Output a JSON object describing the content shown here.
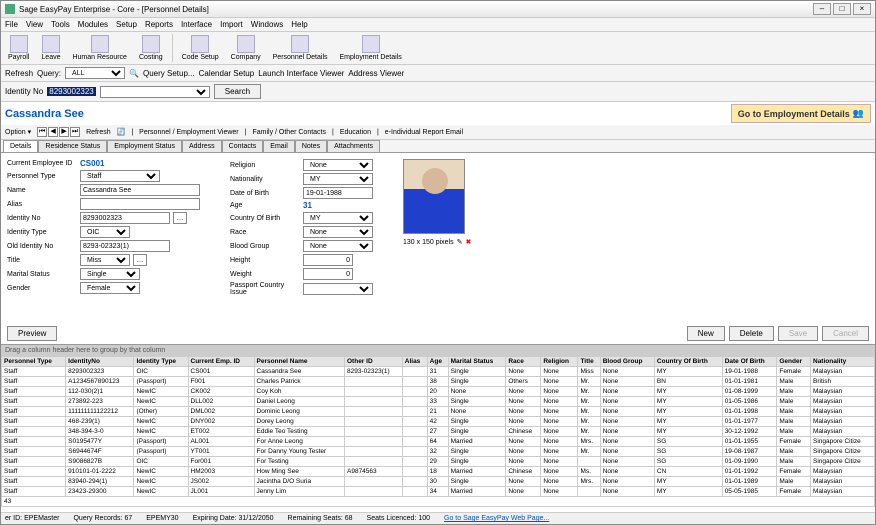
{
  "window": {
    "title": "Sage EasyPay Enterprise - Core - [Personnel Details]"
  },
  "menu": [
    "File",
    "View",
    "Tools",
    "Modules",
    "Setup",
    "Reports",
    "Interface",
    "Import",
    "Windows",
    "Help"
  ],
  "toolbar": [
    "Payroll",
    "Leave",
    "Human Resource",
    "Costing",
    "Code Setup",
    "Company",
    "Personnel Details",
    "Employment Details"
  ],
  "query": {
    "refresh": "Refresh",
    "query": "Query:",
    "all": "ALL",
    "setup": "Query Setup...",
    "calendar": "Calendar Setup",
    "launch": "Launch Interface Viewer",
    "address": "Address Viewer"
  },
  "idbar": {
    "label": "Identity No",
    "value": "8293002323",
    "search": "Search"
  },
  "header": {
    "goto": "Go to  Employment Details"
  },
  "optbar": {
    "option": "Option ▾",
    "refresh": "Refresh",
    "pev": "Personnel / Employment Viewer",
    "family": "Family / Other Contacts",
    "education": "Education",
    "eind": "e-Individual Report Email"
  },
  "tabs": [
    "Details",
    "Residence Status",
    "Employment Status",
    "Address",
    "Contacts",
    "Email",
    "Notes",
    "Attachments"
  ],
  "form": {
    "l": {
      "empid": "Current Employee ID",
      "ptype": "Personnel Type",
      "name": "Name",
      "alias": "Alias",
      "idno": "Identity No",
      "idtype": "Identity Type",
      "oldid": "Old Identity No",
      "title": "Title",
      "marital": "Marital Status",
      "gender": "Gender"
    },
    "r": {
      "religion": "Religion",
      "nat": "Nationality",
      "dob": "Date of Birth",
      "age": "Age",
      "cob": "Country Of Birth",
      "race": "Race",
      "blood": "Blood Group",
      "height": "Height",
      "weight": "Weight",
      "passport": "Passport Country Issue"
    }
  },
  "person": {
    "empid": "CS001",
    "ptype": "Staff",
    "name": "Cassandra See",
    "idno": "8293002323",
    "idtype": "OIC",
    "oldid": "8293-02323(1)",
    "title": "Miss",
    "marital": "Single",
    "gender": "Female",
    "religion": "None",
    "nationality": "MY",
    "dob": "19-01-1988",
    "age": "31",
    "cob": "MY",
    "race": "None",
    "blood": "None",
    "height": "0",
    "weight": "0"
  },
  "photo": {
    "size": "130 x 150 pixels"
  },
  "buttons": {
    "preview": "Preview",
    "new": "New",
    "delete": "Delete",
    "save": "Save",
    "cancel": "Cancel"
  },
  "grid": {
    "hint": "Drag a column header here to group by that column",
    "cols": [
      "Personnel Type",
      "IdentityNo",
      "Identity Type",
      "Current Emp. ID",
      "Personnel Name",
      "Other ID",
      "Alias",
      "Age",
      "Marital Status",
      "Race",
      "Religion",
      "Title",
      "Blood Group",
      "Country Of Birth",
      "Date Of Birth",
      "Gender",
      "Nationality"
    ],
    "rows": [
      [
        "Staff",
        "8293002323",
        "OIC",
        "CS001",
        "Cassandra See",
        "8293-02323(1)",
        "",
        "31",
        "Single",
        "None",
        "None",
        "Miss",
        "None",
        "MY",
        "19-01-1988",
        "Female",
        "Malaysian"
      ],
      [
        "Staff",
        "A1234567890123",
        "(Passport)",
        "F001",
        "Charles Patrick",
        "",
        "",
        "38",
        "Single",
        "Others",
        "None",
        "Mr.",
        "None",
        "BN",
        "01-01-1981",
        "Male",
        "British"
      ],
      [
        "Staff",
        "112-030(2)1",
        "NewIC",
        "CK002",
        "Coy Koh",
        "",
        "",
        "20",
        "None",
        "None",
        "None",
        "Mr.",
        "None",
        "MY",
        "01-08-1999",
        "Male",
        "Malaysian"
      ],
      [
        "Staff",
        "273892-223",
        "NewIC",
        "DLL002",
        "Daniel Leong",
        "",
        "",
        "33",
        "Single",
        "None",
        "None",
        "Mr.",
        "None",
        "MY",
        "01-05-1986",
        "Male",
        "Malaysian"
      ],
      [
        "Staff",
        "111111111122212",
        "(Other)",
        "DML002",
        "Dominic Leong",
        "",
        "",
        "21",
        "None",
        "None",
        "None",
        "Mr.",
        "None",
        "MY",
        "01-01-1998",
        "Male",
        "Malaysian"
      ],
      [
        "Staff",
        "468-239(1)",
        "NewIC",
        "DNY002",
        "Dorey Leong",
        "",
        "",
        "42",
        "Single",
        "None",
        "None",
        "Mr.",
        "None",
        "MY",
        "01-01-1977",
        "Male",
        "Malaysian"
      ],
      [
        "Staff",
        "348-394-3-0",
        "NewIC",
        "ET002",
        "Eddie Teo Testing",
        "",
        "",
        "27",
        "Single",
        "Chinese",
        "None",
        "Mr.",
        "None",
        "MY",
        "30-12-1992",
        "Male",
        "Malaysian"
      ],
      [
        "Staff",
        "S0195477Y",
        "(Passport)",
        "AL001",
        "For Anne Leong",
        "",
        "",
        "64",
        "Married",
        "None",
        "None",
        "Mrs.",
        "None",
        "SG",
        "01-01-1955",
        "Female",
        "Singapore Citize"
      ],
      [
        "Staff",
        "S6944674F",
        "(Passport)",
        "YT001",
        "For Danny Young Tester",
        "",
        "",
        "32",
        "Single",
        "None",
        "None",
        "Mr.",
        "None",
        "SG",
        "19-08-1987",
        "Male",
        "Singapore Citize"
      ],
      [
        "Staff",
        "S9086827B",
        "OIC",
        "For001",
        "For Testing",
        "",
        "",
        "29",
        "Single",
        "None",
        "None",
        "",
        "None",
        "SG",
        "01-09-1990",
        "Male",
        "Singapore Citize"
      ],
      [
        "Staff",
        "910101-01-2222",
        "NewIC",
        "HM2003",
        "How Ming See",
        "A9874563",
        "",
        "18",
        "Married",
        "Chinese",
        "None",
        "Ms.",
        "None",
        "CN",
        "01-01-1992",
        "Female",
        "Malaysian"
      ],
      [
        "Staff",
        "83940-294(1)",
        "NewIC",
        "JS002",
        "Jacintha D/O Suria",
        "",
        "",
        "30",
        "Single",
        "None",
        "None",
        "Mrs.",
        "None",
        "MY",
        "01-01-1989",
        "Male",
        "Malaysian"
      ],
      [
        "Staff",
        "23423-29300",
        "NewIC",
        "JL001",
        "Jenny Lim",
        "",
        "",
        "34",
        "Married",
        "None",
        "None",
        "",
        "None",
        "MY",
        "05-05-1985",
        "Female",
        "Malaysian"
      ]
    ],
    "count": "43"
  },
  "status": {
    "l_userid": "er ID:",
    "userid": "EPEMaster",
    "l_qrec": "Query Records:",
    "qrec": "67",
    "db": "EPEMY30",
    "l_exp": "Expiring Date:",
    "exp": "31/12/2050",
    "l_rem": "Remaining Seats:",
    "rem": "68",
    "l_lic": "Seats Licenced:",
    "lic": "100",
    "link": "Go to Sage EasyPay Web Page..."
  }
}
